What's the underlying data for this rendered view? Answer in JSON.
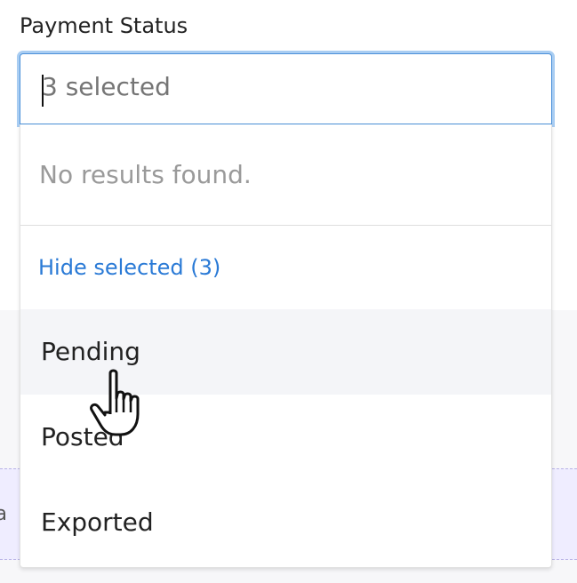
{
  "field": {
    "label": "Payment Status",
    "placeholder": "3 selected"
  },
  "dropdown": {
    "no_results": "No results found.",
    "hide_selected": "Hide selected (3)",
    "options": [
      {
        "label": "Pending",
        "hovered": true
      },
      {
        "label": "Posted",
        "hovered": false
      },
      {
        "label": "Exported",
        "hovered": false
      }
    ]
  },
  "background": {
    "peek_text": "na"
  },
  "colors": {
    "focus_border": "#4a90d9",
    "focus_ring": "#a9cdf2",
    "link": "#2a7ad6",
    "hover_row": "#f4f5f8",
    "panel": "#efedff"
  },
  "icons": {
    "cursor": "hand-pointer-icon"
  }
}
